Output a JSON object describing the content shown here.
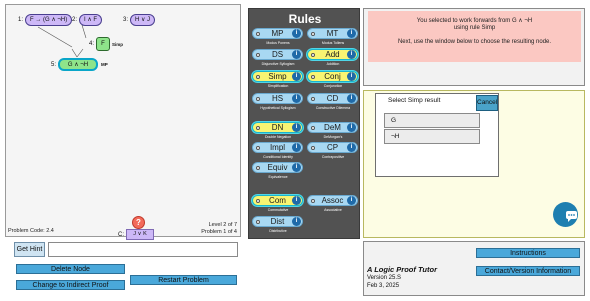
{
  "proof": {
    "nodes": [
      {
        "num": "1:",
        "formula": "F → (G ∧ ¬H)"
      },
      {
        "num": "2:",
        "formula": "I ∧ F"
      },
      {
        "num": "3:",
        "formula": "H ∨ J"
      },
      {
        "num": "4:",
        "formula": "F",
        "rule": "Simp"
      },
      {
        "num": "5:",
        "formula": "G ∧ ¬H",
        "rule": "MP"
      }
    ],
    "goal": {
      "num": "C:",
      "formula": "J ∨ K",
      "icon": "question-icon",
      "mark": "?"
    },
    "problem_code": "Problem Code: 2.4",
    "level": "Level 2 of 7",
    "problem": "Problem 1 of 4"
  },
  "rules_panel": {
    "title": "Rules",
    "rules": [
      {
        "label": "MP",
        "sub": "Modus Ponens"
      },
      {
        "label": "MT",
        "sub": "Modus Tollens"
      },
      {
        "label": "DS",
        "sub": "Disjunctive Syllogism"
      },
      {
        "label": "Add",
        "sub": "Addition"
      },
      {
        "label": "Simp",
        "sub": "Simplification"
      },
      {
        "label": "Conj",
        "sub": "Conjunction"
      },
      {
        "label": "HS",
        "sub": "Hypothetical Syllogism"
      },
      {
        "label": "CD",
        "sub": "Constructive Dilemma"
      },
      {
        "label": "DN",
        "sub": "Double Negation"
      },
      {
        "label": "DeM",
        "sub": "DeMorgan's"
      },
      {
        "label": "Impl",
        "sub": "Conditional Identity"
      },
      {
        "label": "CP",
        "sub": "Contrapositive"
      },
      {
        "label": "Equiv",
        "sub": "Equivalence"
      },
      {
        "label": "Com",
        "sub": "Commutative"
      },
      {
        "label": "Assoc",
        "sub": "Associative"
      },
      {
        "label": "Dist",
        "sub": "Distributive"
      }
    ],
    "info_glyph": "i"
  },
  "message": {
    "line1": "You selected to work forwards from G ∧ ¬H",
    "line2": "using rule Simp",
    "line3": "Next, use the window below to choose the resulting node."
  },
  "dialog": {
    "title": "Select Simp result",
    "cancel_label": "Cancel",
    "options": [
      "G",
      "¬H"
    ]
  },
  "chat": {
    "icon": "chat-bubble-icon"
  },
  "controls": {
    "hint_label": "Get Hint",
    "hint_value": "",
    "delete_label": "Delete Node",
    "indirect_label": "Change to Indirect Proof",
    "restart_label": "Restart Problem"
  },
  "about": {
    "title": "A Logic Proof Tutor",
    "version": "Version 25.S",
    "date": "Feb 3, 2025",
    "instructions_label": "Instructions",
    "contact_label": "Contact/Version Information"
  },
  "colors": {
    "premise": "#cdb8f7",
    "derived": "#8ee48a",
    "rule_button": "#a8d8f2",
    "rule_selected": "#f8f472",
    "message_bg": "#fbc8c2",
    "dialog_frame": "#fdfde4",
    "action_button": "#4aa8da"
  }
}
